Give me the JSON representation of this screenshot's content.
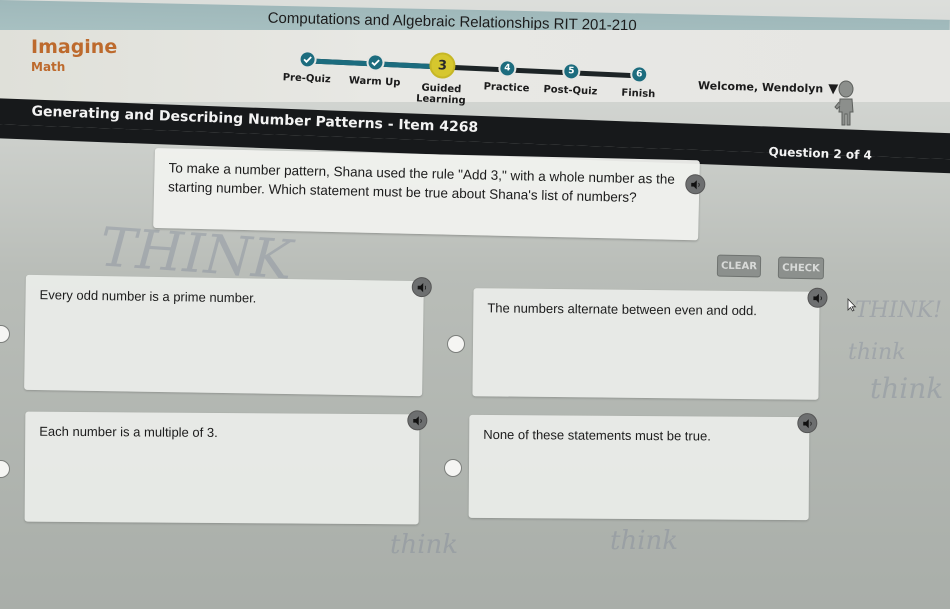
{
  "browser": {
    "tab_title": "Computations and Algebraic Relationships RIT 201-210"
  },
  "brand": {
    "name": "Imagine",
    "product": "Math",
    "color": "#bd6a2d"
  },
  "progress": {
    "current_step": 3,
    "steps": [
      {
        "marker": "check-icon",
        "label": "Pre-Quiz",
        "status": "complete"
      },
      {
        "marker": "check-icon",
        "label": "Warm Up",
        "status": "complete"
      },
      {
        "marker": "3",
        "label": "Guided Learning",
        "status": "current"
      },
      {
        "marker": "4",
        "label": "Practice",
        "status": "upcoming"
      },
      {
        "marker": "5",
        "label": "Post-Quiz",
        "status": "upcoming"
      },
      {
        "marker": "6",
        "label": "Finish",
        "status": "upcoming"
      }
    ],
    "colors": {
      "complete": "#1c6c7e",
      "current": "#d6c72e",
      "track": "#1d2426"
    }
  },
  "user": {
    "welcome": "Welcome, Wendolyn",
    "menu_icon": "caret-down-icon",
    "avatar_icon": "avatar-figure-icon"
  },
  "lesson": {
    "title": "Generating and Describing Number Patterns - Item 4268",
    "question_counter": "Question 2 of 4"
  },
  "question": {
    "prompt": "To make a number pattern, Shana used the rule \"Add 3,\" with a whole number as the starting number. Which statement must be true about Shana's list of numbers?",
    "audio_icon": "speaker-icon"
  },
  "actions": {
    "clear_label": "CLEAR",
    "check_label": "CHECK"
  },
  "options": [
    {
      "text": "Every odd number is a prime number.",
      "selected": false
    },
    {
      "text": "The numbers alternate between even and odd.",
      "selected": false
    },
    {
      "text": "Each number is a multiple of 3.",
      "selected": false
    },
    {
      "text": "None of these statements must be true.",
      "selected": false
    }
  ],
  "background_doodles": [
    "THINK",
    "think",
    "think",
    "THINK!",
    "think",
    "think"
  ]
}
